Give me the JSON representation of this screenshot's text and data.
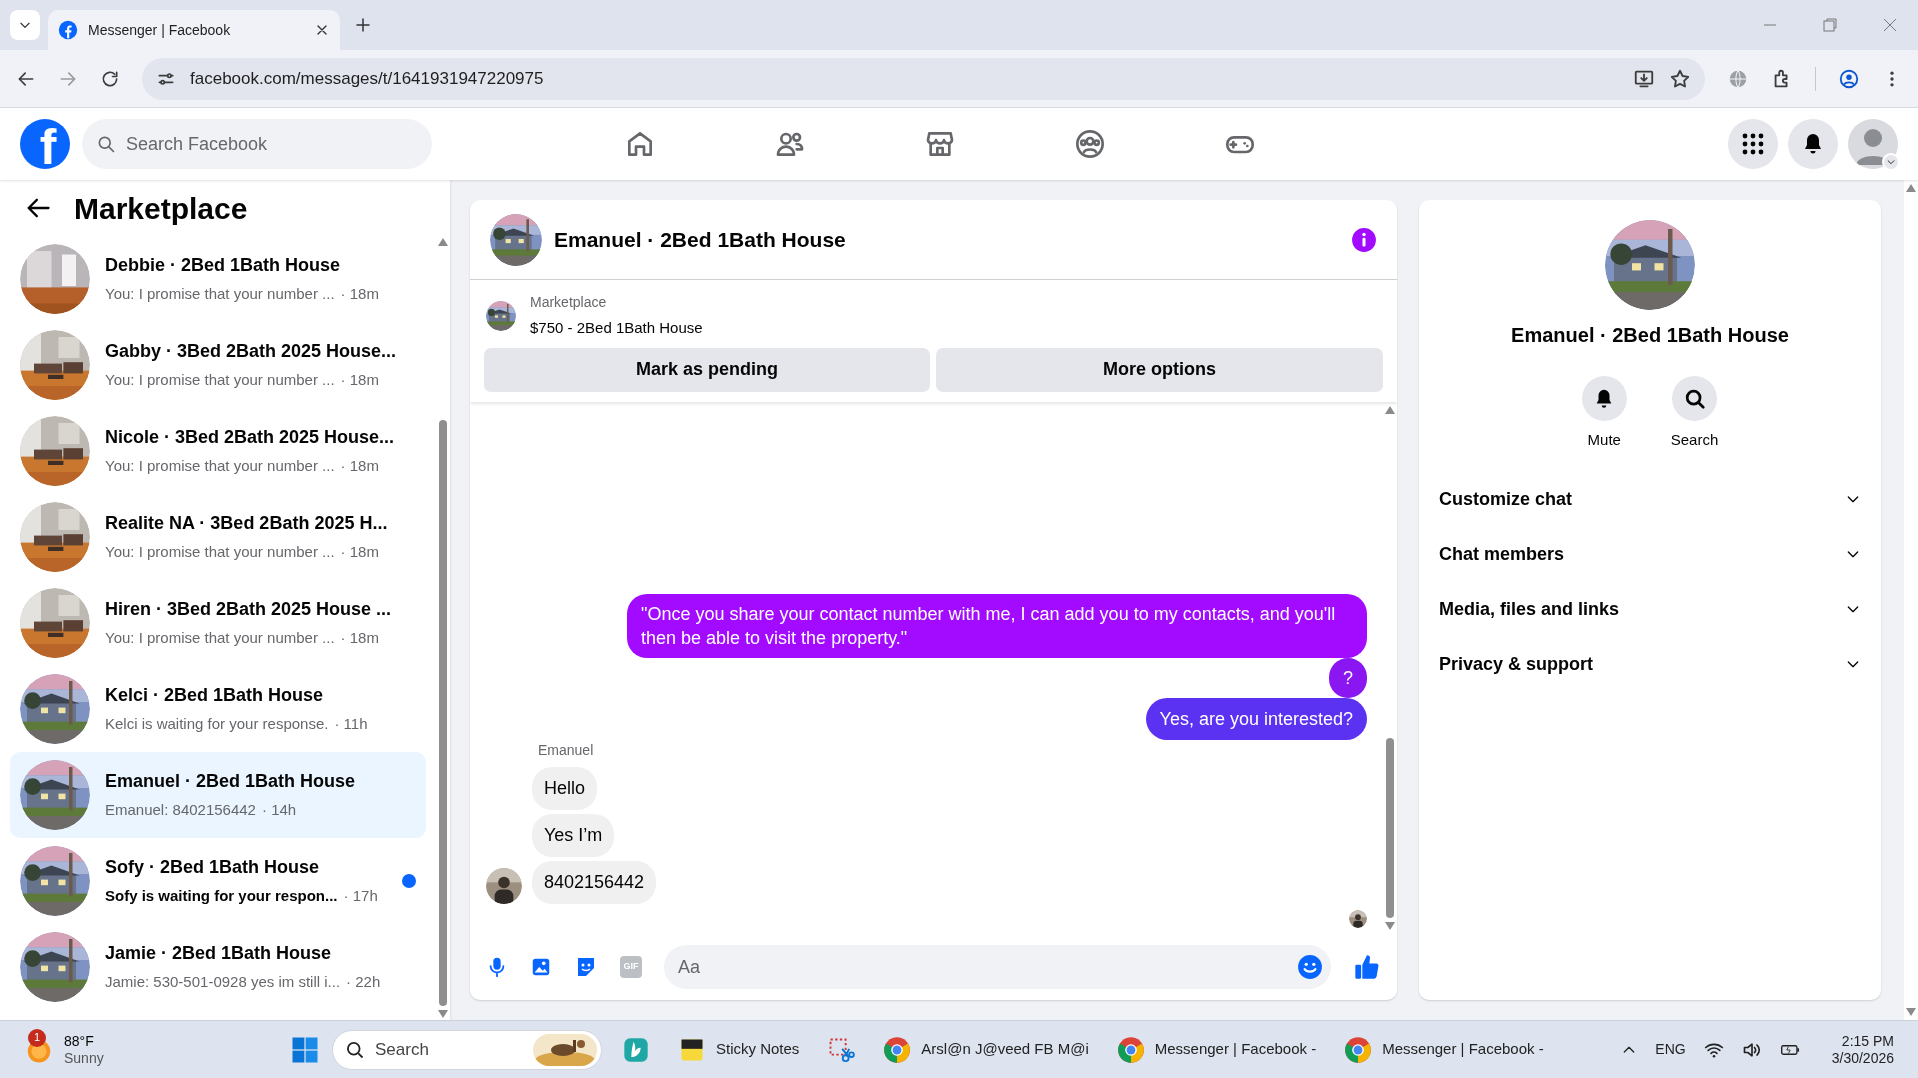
{
  "browser": {
    "tab_title": "Messenger | Facebook",
    "url": "facebook.com/messages/t/1641931947220975"
  },
  "header": {
    "logo": "f",
    "search_placeholder": "Search Facebook"
  },
  "sidebar": {
    "title": "Marketplace",
    "conversations": [
      {
        "title": "Debbie · 2Bed 1Bath House",
        "preview": "You: I promise that your number ...",
        "time": "· 18m",
        "selected": false,
        "unread": false
      },
      {
        "title": "Gabby · 3Bed 2Bath 2025 House...",
        "preview": "You: I promise that your number ...",
        "time": "· 18m",
        "selected": false,
        "unread": false
      },
      {
        "title": "Nicole · 3Bed 2Bath 2025 House...",
        "preview": "You: I promise that your number ...",
        "time": "· 18m",
        "selected": false,
        "unread": false
      },
      {
        "title": "Realite NA · 3Bed 2Bath 2025 H...",
        "preview": "You: I promise that your number ...",
        "time": "· 18m",
        "selected": false,
        "unread": false
      },
      {
        "title": "Hiren · 3Bed 2Bath 2025 House ...",
        "preview": "You: I promise that your number ...",
        "time": "· 18m",
        "selected": false,
        "unread": false
      },
      {
        "title": "Kelci · 2Bed 1Bath House",
        "preview": "Kelci is waiting for your response.",
        "time": "· 11h",
        "selected": false,
        "unread": false
      },
      {
        "title": "Emanuel · 2Bed 1Bath House",
        "preview": "Emanuel: 8402156442",
        "time": "· 14h",
        "selected": true,
        "unread": false
      },
      {
        "title": "Sofy · 2Bed 1Bath House",
        "preview": "Sofy is waiting for your respon...",
        "time": "· 17h",
        "selected": false,
        "unread": true
      },
      {
        "title": "Jamie · 2Bed 1Bath House",
        "preview": "Jamie: 530-501-0928 yes im still i...",
        "time": "· 22h",
        "selected": false,
        "unread": false
      }
    ]
  },
  "chat": {
    "title": "Emanuel · 2Bed 1Bath House",
    "listing": {
      "label": "Marketplace",
      "title": "$750 - 2Bed 1Bath House"
    },
    "actions": [
      "Mark as pending",
      "More options"
    ],
    "messages": [
      {
        "kind": "outgoing",
        "text": "\"Once you share your contact number with me, I can add you to my contacts, and you'll then be able to visit the property.\"",
        "color": "#a20bff"
      },
      {
        "kind": "outgoing",
        "text": "?",
        "color": "#8a17f2"
      },
      {
        "kind": "outgoing",
        "text": "Yes, are you interested?",
        "color": "#5b31f2"
      },
      {
        "kind": "sender_name",
        "text": "Emanuel"
      },
      {
        "kind": "incoming",
        "text": "Hello",
        "avatar": false
      },
      {
        "kind": "incoming",
        "text": "Yes I’m",
        "avatar": false
      },
      {
        "kind": "incoming",
        "text": "8402156442",
        "avatar": true
      }
    ],
    "gif_label": "GIF",
    "composer": {
      "placeholder": "Aa"
    }
  },
  "details": {
    "title": "Emanuel · 2Bed 1Bath House",
    "actions": [
      {
        "kind": "bell",
        "label": "Mute"
      },
      {
        "kind": "search",
        "label": "Search"
      }
    ],
    "sections": [
      {
        "label": "Customize chat",
        "expanded": false
      },
      {
        "label": "Chat members",
        "expanded": false
      },
      {
        "label": "Media, files and links",
        "expanded": false
      },
      {
        "label": "Privacy & support",
        "expanded": false
      }
    ]
  },
  "taskbar": {
    "weather": {
      "badge": "1",
      "temperature": "88°F",
      "condition": "Sunny"
    },
    "search_placeholder": "Search",
    "apps": [
      {
        "kind": "surfshark"
      },
      {
        "kind": "sticky",
        "label": "Sticky Notes"
      },
      {
        "kind": "snip"
      },
      {
        "kind": "chrome",
        "label": "Arsl@n J@veed FB M@i"
      },
      {
        "kind": "chrome",
        "label": "Messenger | Facebook -"
      },
      {
        "kind": "chrome",
        "label": "Messenger | Facebook -"
      }
    ],
    "language": "ENG",
    "time": "2:15 PM",
    "date": "3/30/2026"
  }
}
